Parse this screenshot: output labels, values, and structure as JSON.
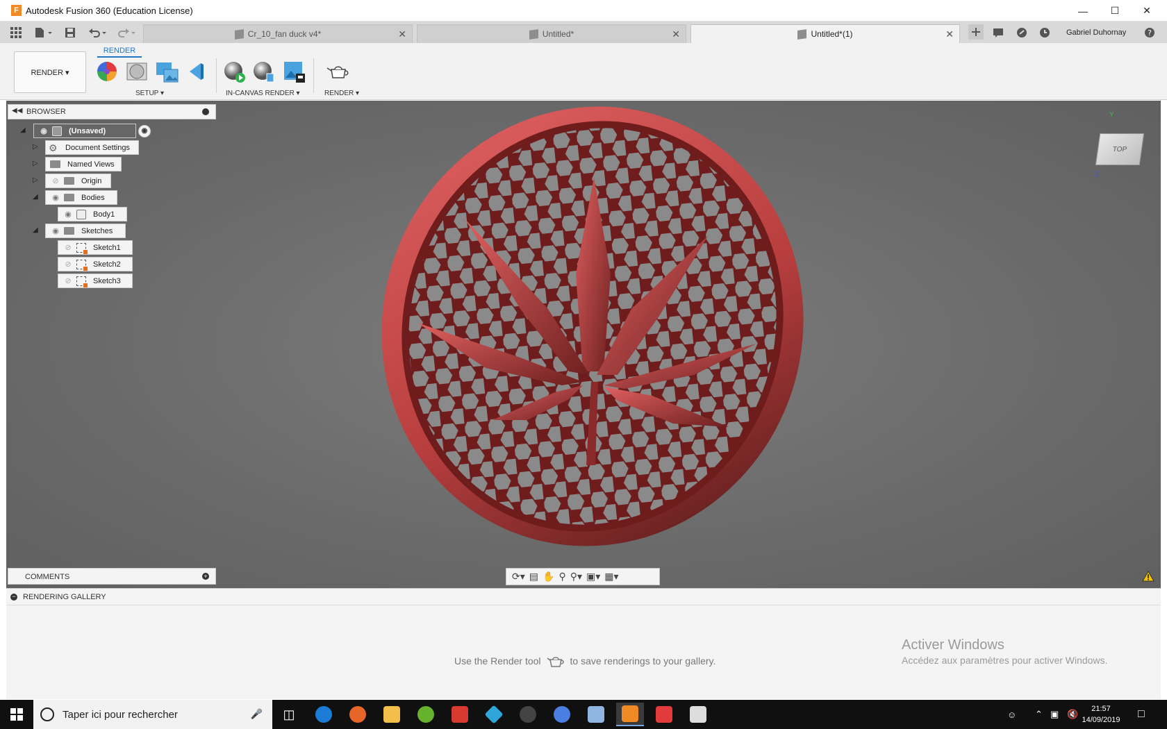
{
  "window": {
    "title": "Autodesk Fusion 360 (Education License)"
  },
  "tabs": [
    {
      "label": "Cr_10_fan duck v4*",
      "active": false
    },
    {
      "label": "Untitled*",
      "active": false
    },
    {
      "label": "Untitled*(1)",
      "active": true
    }
  ],
  "user": {
    "name": "Gabriel Duhornay"
  },
  "toolbar": {
    "workspace_label": "RENDER ▾",
    "tab_label": "RENDER",
    "groups": [
      "SETUP ▾",
      "IN-CANVAS RENDER ▾",
      "RENDER ▾"
    ]
  },
  "browser": {
    "title": "BROWSER",
    "root": "(Unsaved)",
    "items": [
      {
        "label": "Document Settings"
      },
      {
        "label": "Named Views"
      },
      {
        "label": "Origin"
      },
      {
        "label": "Bodies"
      },
      {
        "label": "Body1"
      },
      {
        "label": "Sketches"
      },
      {
        "label": "Sketch1"
      },
      {
        "label": "Sketch2"
      },
      {
        "label": "Sketch3"
      }
    ]
  },
  "comments": {
    "label": "COMMENTS"
  },
  "viewcube": {
    "face": "TOP",
    "axis_y": "Y",
    "axis_z": "Z"
  },
  "gallery": {
    "title": "RENDERING GALLERY",
    "hint_before": "Use the Render tool",
    "hint_after": "to save renderings to your gallery."
  },
  "watermark": {
    "title": "Activer Windows",
    "subtitle": "Accédez aux paramètres pour activer Windows."
  },
  "taskbar": {
    "search_placeholder": "Taper ici pour rechercher",
    "time": "21:57",
    "date": "14/09/2019"
  },
  "colors": {
    "accent": "#1e78c8",
    "model": "#c84a4a",
    "viewport": "#707070"
  }
}
